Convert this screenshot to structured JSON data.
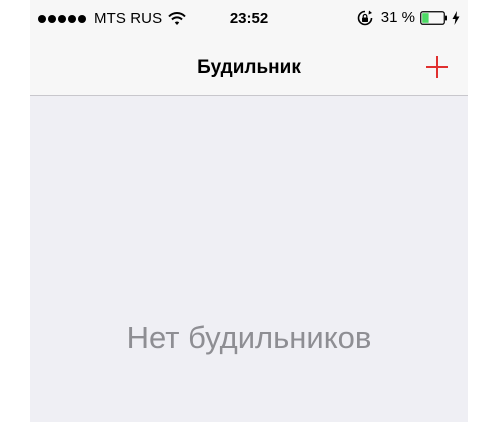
{
  "status_bar": {
    "carrier": "MTS RUS",
    "time": "23:52",
    "battery_percent": "31 %",
    "battery_level": 0.31,
    "icons": [
      "signal-dots",
      "wifi-icon",
      "rotation-lock-icon",
      "battery-icon",
      "charging-bolt-icon"
    ]
  },
  "nav_bar": {
    "title": "Будильник",
    "add_icon": "plus-icon"
  },
  "main": {
    "empty_message": "Нет будильников"
  },
  "colors": {
    "accent": "#e0302f",
    "battery_green": "#4cd964",
    "background": "#efeff4",
    "bar_background": "#f7f7f7",
    "placeholder_text": "#8e8e93"
  }
}
